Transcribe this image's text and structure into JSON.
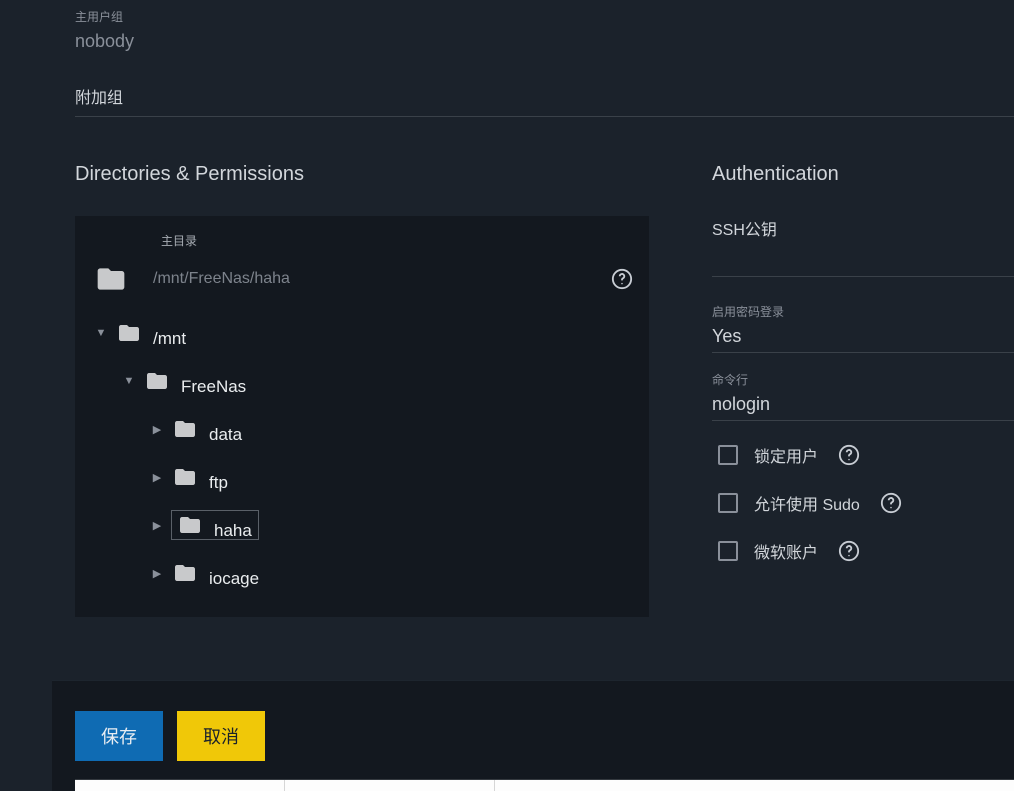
{
  "primaryGroup": {
    "label": "主用户组",
    "value": "nobody"
  },
  "additionalGroup": {
    "label": "附加组"
  },
  "directories": {
    "title": "Directories & Permissions",
    "homeDirLabel": "主目录",
    "homeDirPath": "/mnt/FreeNas/haha",
    "tree": {
      "root": "/mnt",
      "child": "FreeNas",
      "grandchildren": [
        {
          "name": "data",
          "selected": false
        },
        {
          "name": "ftp",
          "selected": false
        },
        {
          "name": "haha",
          "selected": true
        },
        {
          "name": "iocage",
          "selected": false
        }
      ]
    }
  },
  "authentication": {
    "title": "Authentication",
    "sshKeyLabel": "SSH公钥",
    "enablePasswordLabel": "启用密码登录",
    "enablePasswordValue": "Yes",
    "shellLabel": "命令行",
    "shellValue": "nologin",
    "checks": {
      "lockUser": "锁定用户",
      "allowSudo": "允许使用 Sudo",
      "msAccount": "微软账户"
    }
  },
  "buttons": {
    "save": "保存",
    "cancel": "取消"
  }
}
